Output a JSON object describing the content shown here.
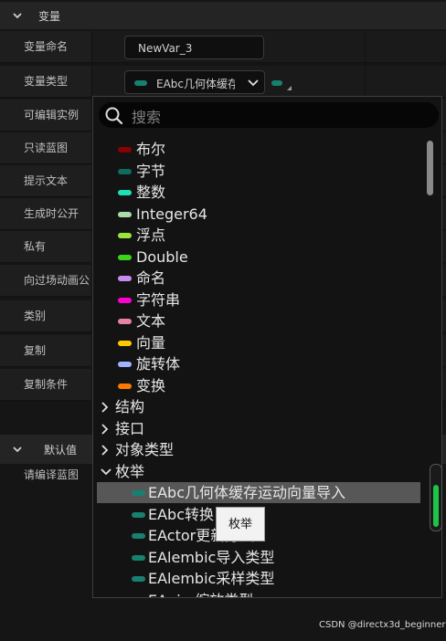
{
  "variables_section": {
    "title": "变量"
  },
  "properties": [
    {
      "label": "变量命名"
    },
    {
      "label": "变量类型"
    },
    {
      "label": "可编辑实例"
    },
    {
      "label": "只读蓝图"
    },
    {
      "label": "提示文本"
    },
    {
      "label": "生成时公开"
    },
    {
      "label": "私有"
    },
    {
      "label": "向过场动画公"
    },
    {
      "label": "类别"
    },
    {
      "label": "复制"
    },
    {
      "label": "复制条件"
    }
  ],
  "var_name_value": "NewVar_3",
  "var_type_value": "EAbc几何体缓存运动向量导入",
  "default_section": {
    "title": "默认值",
    "row_label": "请编译蓝图"
  },
  "search": {
    "placeholder": "搜索"
  },
  "type_items": [
    {
      "name": "布尔",
      "color": "#8c0000"
    },
    {
      "name": "字节",
      "color": "#0f6b60"
    },
    {
      "name": "整数",
      "color": "#1ee0b4"
    },
    {
      "name": "Integer64",
      "color": "#a8dca8"
    },
    {
      "name": "浮点",
      "color": "#9be63c"
    },
    {
      "name": "Double",
      "color": "#3ad41a"
    },
    {
      "name": "命名",
      "color": "#c88cf0"
    },
    {
      "name": "字符串",
      "color": "#ff00d2"
    },
    {
      "name": "文本",
      "color": "#e682a8"
    },
    {
      "name": "向量",
      "color": "#ffc800"
    },
    {
      "name": "旋转体",
      "color": "#a0b4ff"
    },
    {
      "name": "变换",
      "color": "#ff7800"
    }
  ],
  "categories": [
    {
      "name": "结构",
      "expanded": false
    },
    {
      "name": "接口",
      "expanded": false
    },
    {
      "name": "对象类型",
      "expanded": false
    },
    {
      "name": "枚举",
      "expanded": true
    }
  ],
  "enum_items": [
    {
      "name": "EAbc几何体缓存运动向量导入",
      "selected": true
    },
    {
      "name": "EAbc转换",
      "selected": false
    },
    {
      "name": "EActor更新方法",
      "selected": false
    },
    {
      "name": "EAlembic导入类型",
      "selected": false
    },
    {
      "name": "EAlembic采样类型",
      "selected": false
    },
    {
      "name": "EAnim缩放类型",
      "selected": false
    }
  ],
  "tooltip": "枚举",
  "watermark": "CSDN @directx3d_beginner"
}
